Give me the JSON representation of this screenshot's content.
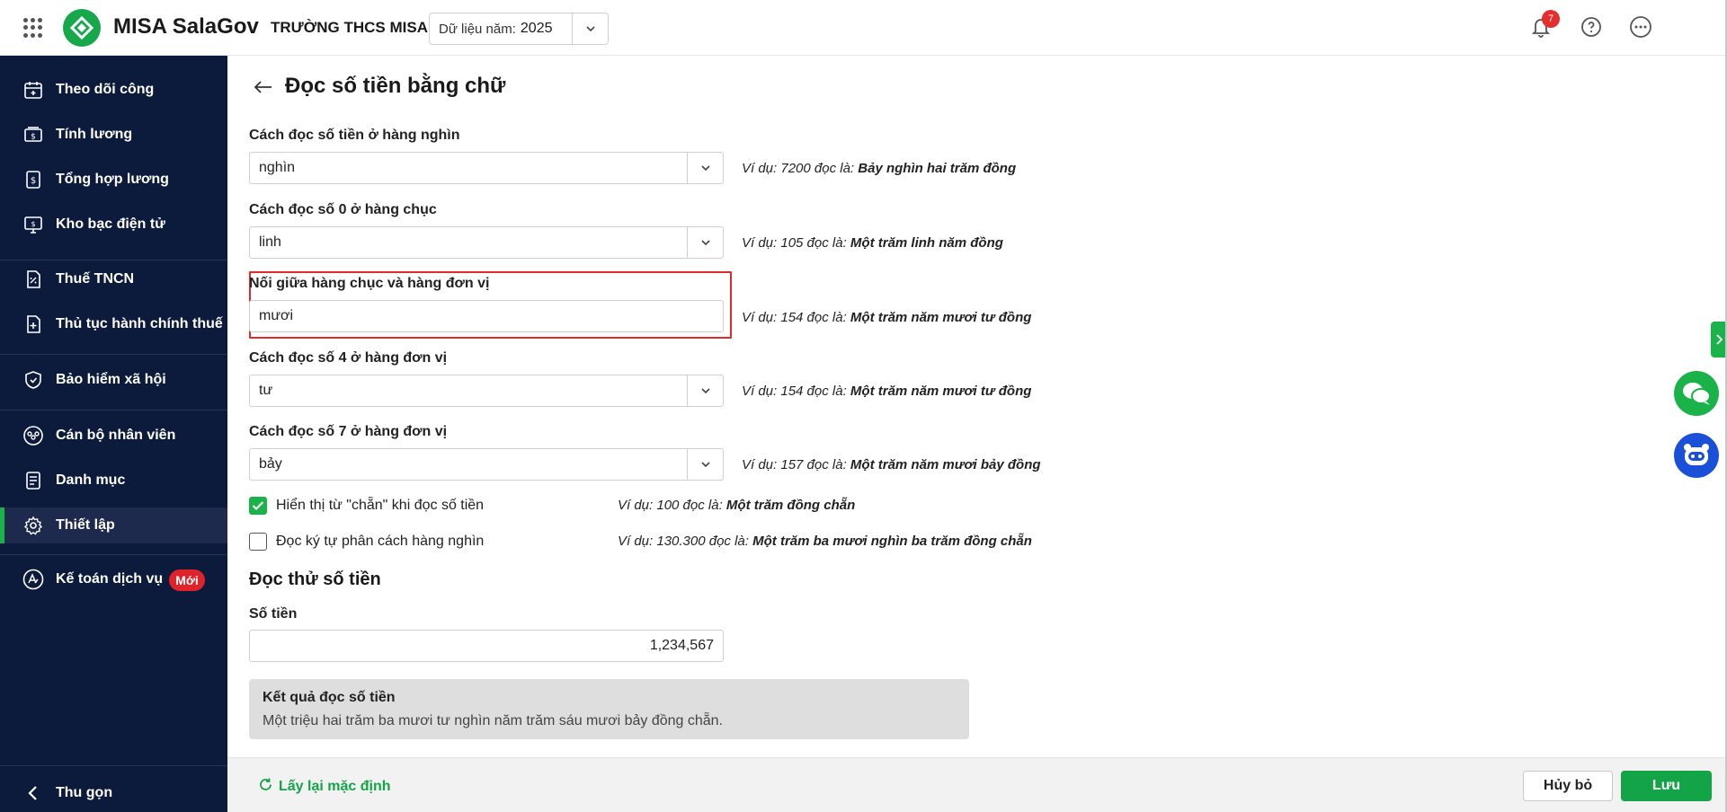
{
  "topbar": {
    "app_title": "MISA SalaGov",
    "org_name": "TRƯỜNG THCS MISA",
    "year_label": "Dữ liệu năm:",
    "year_value": "2025",
    "notification_count": "7"
  },
  "sidebar": {
    "items": [
      {
        "label": "Theo dõi công",
        "icon": "calendar-icon"
      },
      {
        "label": "Tính lương",
        "icon": "money-icon"
      },
      {
        "label": "Tổng hợp lương",
        "icon": "document-money-icon"
      },
      {
        "label": "Kho bạc điện tử",
        "icon": "monitor-money-icon"
      },
      {
        "label": "Thuế TNCN",
        "icon": "tax-document-icon"
      },
      {
        "label": "Thủ tục hành chính thuế",
        "icon": "document-plus-icon"
      },
      {
        "label": "Bảo hiểm xã hội",
        "icon": "shield-icon"
      },
      {
        "label": "Cán bộ nhân viên",
        "icon": "people-icon"
      },
      {
        "label": "Danh mục",
        "icon": "list-icon"
      },
      {
        "label": "Thiết lập",
        "icon": "gear-icon"
      },
      {
        "label": "Kế toán dịch vụ",
        "icon": "accounting-icon",
        "badge": "Mới"
      }
    ],
    "collapse_label": "Thu gọn"
  },
  "page": {
    "title": "Đọc số tiền bằng chữ",
    "fields": [
      {
        "label": "Cách đọc số tiền ở hàng nghìn",
        "value": "nghìn",
        "example_prefix": "Ví dụ: 7200 đọc là:",
        "example_result": "Bảy nghìn hai trăm đồng"
      },
      {
        "label": "Cách đọc số 0 ở hàng chục",
        "value": "linh",
        "example_prefix": "Ví dụ: 105 đọc là:",
        "example_result": "Một trăm linh năm đồng"
      },
      {
        "label": "Nối giữa hàng chục và hàng đơn vị",
        "value": "mươi",
        "example_prefix": "Ví dụ: 154 đọc là:",
        "example_result": "Một trăm năm mươi tư đồng"
      },
      {
        "label": "Cách đọc số 4 ở hàng đơn vị",
        "value": "tư",
        "example_prefix": "Ví dụ: 154 đọc là:",
        "example_result": "Một trăm năm mươi tư đồng"
      },
      {
        "label": "Cách đọc số 7 ở hàng đơn vị",
        "value": "bảy",
        "example_prefix": "Ví dụ: 157 đọc là:",
        "example_result": "Một trăm năm mươi bảy đồng"
      }
    ],
    "checkboxes": [
      {
        "label": "Hiển thị từ \"chẵn\" khi đọc số tiền",
        "checked": true,
        "example_prefix": "Ví dụ: 100 đọc là:",
        "example_result": "Một trăm đồng chẵn"
      },
      {
        "label": "Đọc ký tự phân cách hàng nghìn",
        "checked": false,
        "example_prefix": "Ví dụ: 130.300 đọc là:",
        "example_result": "Một trăm ba mươi nghìn ba trăm đồng chẵn"
      }
    ],
    "test_section": {
      "title": "Đọc thử số tiền",
      "amount_label": "Số tiền",
      "amount_value": "1,234,567",
      "result_title": "Kết quả đọc số tiền",
      "result_value": "Một triệu hai trăm ba mươi tư nghìn năm trăm sáu mươi bảy đồng chẵn."
    }
  },
  "footer": {
    "reset_label": "Lấy lại mặc định",
    "cancel_label": "Hủy bỏ",
    "save_label": "Lưu"
  },
  "colors": {
    "brand_green": "#19b34a",
    "sidebar_bg": "#0c1a3c",
    "highlight_red": "#e02b2b",
    "bot_blue": "#1a4fd8"
  }
}
